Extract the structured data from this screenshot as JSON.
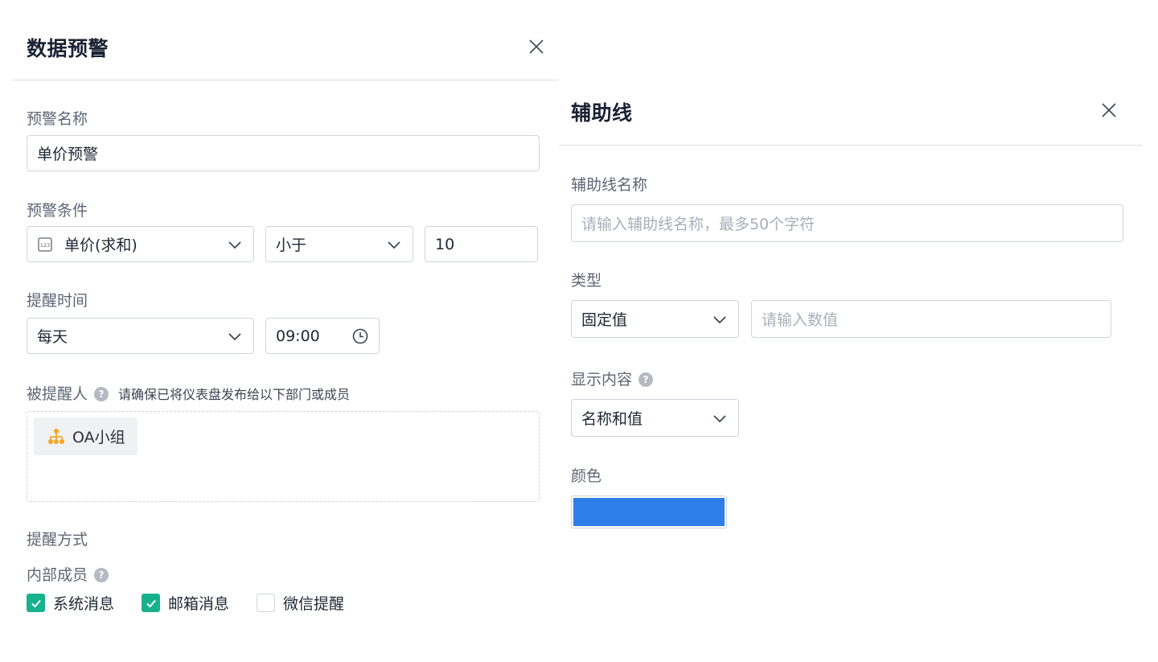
{
  "alert": {
    "title": "数据预警",
    "name_label": "预警名称",
    "name_value": "单价预警",
    "condition_label": "预警条件",
    "condition_field": "单价(求和)",
    "condition_operator": "小于",
    "condition_value": "10",
    "time_label": "提醒时间",
    "time_frequency": "每天",
    "time_value": "09:00",
    "recipients_label": "被提醒人",
    "recipients_hint": "请确保已将仪表盘发布给以下部门或成员",
    "recipient_tag": "OA小组",
    "method_label": "提醒方式",
    "internal_label": "内部成员",
    "checks": [
      {
        "label": "系统消息",
        "checked": true
      },
      {
        "label": "邮箱消息",
        "checked": true
      },
      {
        "label": "微信提醒",
        "checked": false
      }
    ]
  },
  "aux": {
    "title": "辅助线",
    "name_label": "辅助线名称",
    "name_placeholder": "请输入辅助线名称，最多50个字符",
    "type_label": "类型",
    "type_value": "固定值",
    "value_placeholder": "请输入数值",
    "display_label": "显示内容",
    "display_value": "名称和值",
    "color_label": "颜色",
    "color_value": "#2f7de8"
  },
  "colors": {
    "accent": "#17b28d",
    "tag_icon": "#f5a623",
    "help_icon": "#b4b9c2"
  },
  "icons": {
    "close": "close-icon",
    "chevron": "chevron-down-icon",
    "clock": "clock-icon",
    "number": "number-type-icon",
    "org": "org-structure-icon",
    "help": "help-icon",
    "check": "checkmark-icon"
  }
}
